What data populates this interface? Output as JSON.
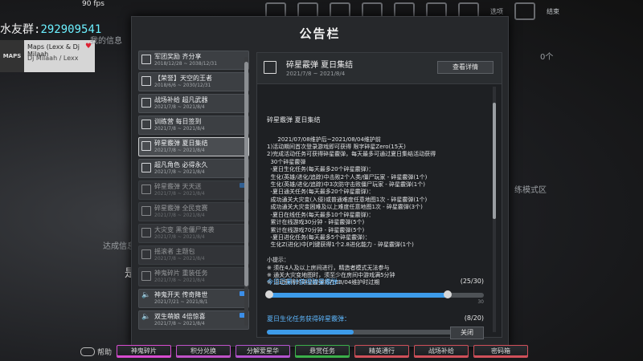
{
  "overlay": {
    "fps": "90 fps",
    "qq_label": "水友群:",
    "qq_number": "292909541",
    "stream_logo": "MAPS",
    "stream_line1": "Maps (Lexx & Dj Milaah",
    "stream_line2": "Dj Milaah / Lexx"
  },
  "topnav": {
    "options": "选项",
    "exit": "结束",
    "count": "0个"
  },
  "background": {
    "my_info": "我的信息",
    "goal": "达成信息",
    "tag": "是",
    "side": "练模式区"
  },
  "modal": {
    "title": "公告栏",
    "list": [
      {
        "title": "军团奖励 齐分享",
        "date": "2018/12/28 ~ 2038/12/31",
        "selected": false,
        "dim": false,
        "icon": "calendar-icon",
        "badge": false
      },
      {
        "title": "【荣誉】天空的王者",
        "date": "2018/6/6 ~ 2030/12/31",
        "selected": false,
        "dim": false,
        "icon": "calendar-icon",
        "badge": false
      },
      {
        "title": "战场补给 超凡武器",
        "date": "2021/7/8 ~ 2021/8/4",
        "selected": false,
        "dim": false,
        "icon": "calendar-icon",
        "badge": false
      },
      {
        "title": "训练营 每日签到",
        "date": "2021/7/8 ~ 2021/8/4",
        "selected": false,
        "dim": false,
        "icon": "calendar-icon",
        "badge": false
      },
      {
        "title": "碎星霰弹 夏日集结",
        "date": "2021/7/8 ~ 2021/8/4",
        "selected": true,
        "dim": false,
        "icon": "calendar-icon",
        "badge": false
      },
      {
        "title": "超凡角色 必得永久",
        "date": "2021/7/8 ~ 2021/8/4",
        "selected": false,
        "dim": false,
        "icon": "calendar-icon",
        "badge": false
      },
      {
        "title": "碎星霰弹 天天送",
        "date": "2021/7/8 ~ 2021/8/4",
        "selected": false,
        "dim": true,
        "icon": "calendar-icon",
        "badge": true
      },
      {
        "title": "碎星霰弹 全民竞赛",
        "date": "2021/7/8 ~ 2021/8/4",
        "selected": false,
        "dim": true,
        "icon": "calendar-icon",
        "badge": false
      },
      {
        "title": "大灾变 黑金僵尸来袭",
        "date": "2021/7/8 ~ 2021/8/4",
        "selected": false,
        "dim": true,
        "icon": "calendar-icon",
        "badge": false
      },
      {
        "title": "摇滚者 主题包",
        "date": "2021/7/8 ~ 2021/8/4",
        "selected": false,
        "dim": true,
        "icon": "calendar-icon",
        "badge": false
      },
      {
        "title": "神鬼碎片 重装任务",
        "date": "2021/7/8 ~ 2021/8/4",
        "selected": false,
        "dim": true,
        "icon": "calendar-icon",
        "badge": false
      },
      {
        "title": "神鬼开天 传奇降世",
        "date": "2021/7/21 ~ 2021/8/1",
        "selected": false,
        "dim": false,
        "icon": "speaker-icon",
        "badge": true
      },
      {
        "title": "双生萌娘 4倍惊喜",
        "date": "2021/7/8 ~ 2021/8/4",
        "selected": false,
        "dim": false,
        "icon": "speaker-icon",
        "badge": true
      }
    ],
    "detail": {
      "title": "碎星霰弹 夏日集结",
      "date": "2021/7/8 ~ 2021/8/4",
      "detail_button": "查看详情",
      "heading": "碎星霰弹 夏日集结",
      "body": "2021/07/08维护后~2021/08/04维护前\n1)活动期间首次登录游戏即可获得 限字碎星Zero(15天)\n2)完成活动任务可获得碎星霰弹，每天最多可通过夏日集结活动获得\n  30个碎星霰弹\n  -夏日生化任务(每天最多20个碎星霰弹)：\n  生化(英雄/进化/追踪)中击败2个人类/僵尸玩家 - 碎星霰弹(1个)\n  生化(英雄/进化/追踪)中3次防守击败僵尸玩家 - 碎星霰弹(1个)\n  -夏日通关任务(每天最多20个碎星霰弹)：\n  成功通关大灾变(入侵)或普通难度任意地图1次 - 碎星霰弹(1个)\n  成功通关大灾变困难及以上难度任意地图1次 - 碎星霰弹(3个)\n  -夏日在线任务(每天最多10个碎星霰弹)：\n  累计在线游戏30分钟 - 碎星霰弹(5个)\n  累计在线游戏70分钟 - 碎星霰弹(5个)\n  -夏日进化任务(每天最多5个碎星霰弹)：\n  生化Z(进化)中[P]键获得1个2.8进化能力 - 碎星霰弹(1个)\n\n小提示：\n※ 须在4人及以上房间进行，精造者模式无法参与\n※ 通关大灾变地图时，须至少在房间中游戏满5分钟\n※ 活动获得的碎星霰弹将在08/04维护时过期",
      "progress": [
        {
          "label": "今日已累计获得碎星霰弹：",
          "value": "(25/30)",
          "fraction": 0.833,
          "end_tick": "30"
        },
        {
          "label": "夏日生化任务获得碎星霰弹：",
          "value": "(8/20)",
          "fraction": 0.4,
          "end_tick": ""
        }
      ],
      "close_button": "关闭"
    }
  },
  "bottombar": {
    "help": "帮助",
    "buttons": [
      {
        "label": "神鬼碎片",
        "color": "#d84bd0"
      },
      {
        "label": "积分兑换",
        "color": "#c052c8"
      },
      {
        "label": "分解爱星华",
        "color": "#b653d0"
      },
      {
        "label": "悬赏任务",
        "color": "#3bb04a"
      },
      {
        "label": "精英通行",
        "color": "#d0505a"
      },
      {
        "label": "战场补给",
        "color": "#d0505a"
      },
      {
        "label": "密码箱",
        "color": "#d0505a"
      }
    ]
  }
}
